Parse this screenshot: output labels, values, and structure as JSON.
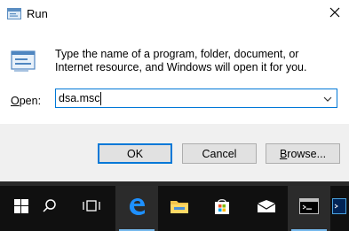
{
  "window": {
    "title": "Run",
    "description": "Type the name of a program, folder, document, or Internet resource, and Windows will open it for you.",
    "open_label_prefix": "",
    "open_label_mnemonic": "O",
    "open_label_rest": "pen:",
    "input_value": "dsa.msc"
  },
  "buttons": {
    "ok": "OK",
    "cancel": "Cancel",
    "browse_mnemonic": "B",
    "browse_rest": "rowse..."
  },
  "icons": {
    "title": "run-icon",
    "close": "close-icon",
    "dropdown": "chevron-down-icon"
  },
  "taskbar": {
    "items": [
      "start-icon",
      "search-icon",
      "task-view-icon",
      "edge-icon",
      "file-explorer-icon",
      "store-icon",
      "mail-icon",
      "cmd-icon",
      "terminal-icon"
    ]
  },
  "colors": {
    "accent": "#0078d7",
    "taskbar": "#101010",
    "footer": "#f0f0f0"
  }
}
